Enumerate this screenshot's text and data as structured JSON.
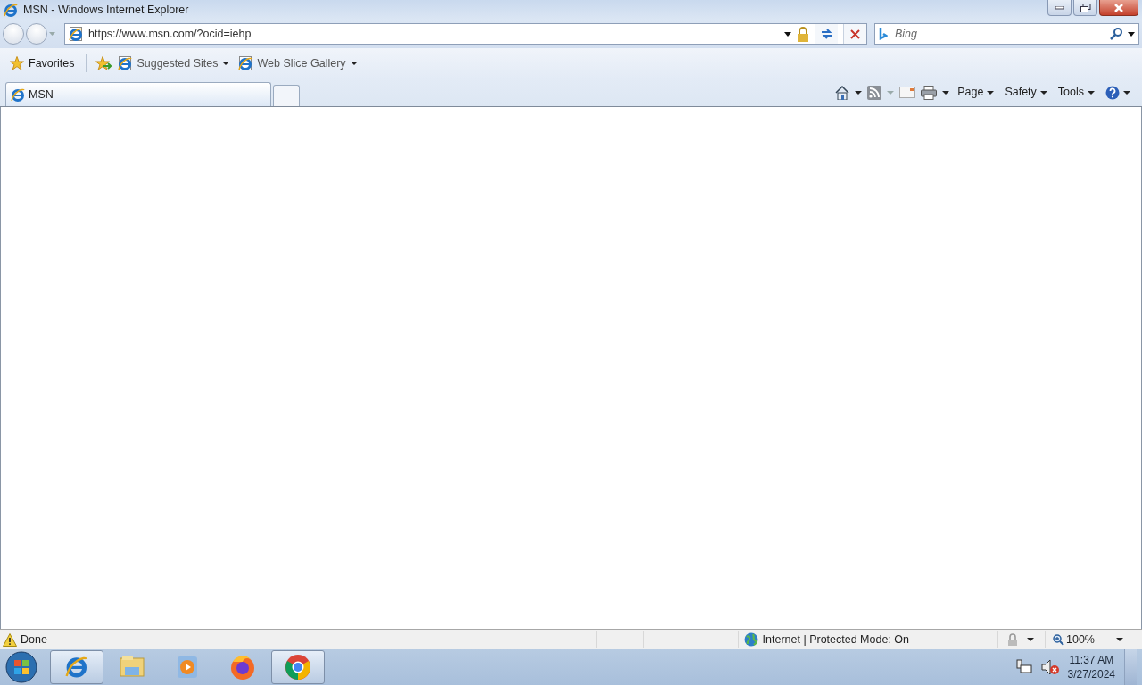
{
  "window": {
    "title": "MSN - Windows Internet Explorer"
  },
  "address_bar": {
    "url": "https://www.msn.com/?ocid=iehp"
  },
  "search": {
    "placeholder": "Bing"
  },
  "favorites_bar": {
    "label": "Favorites",
    "links": [
      {
        "label": "Suggested Sites"
      },
      {
        "label": "Web Slice Gallery"
      }
    ]
  },
  "tabs": [
    {
      "label": "MSN",
      "selected": true
    }
  ],
  "command_bar": {
    "menus": [
      {
        "label": "Page"
      },
      {
        "label": "Safety"
      },
      {
        "label": "Tools"
      }
    ]
  },
  "status_bar": {
    "text": "Done",
    "zone": "Internet | Protected Mode: On",
    "zoom": "100%"
  },
  "taskbar": {
    "apps": [
      {
        "kind": "ie",
        "running": true
      },
      {
        "kind": "explorer",
        "running": false
      },
      {
        "kind": "media",
        "running": false
      },
      {
        "kind": "firefox",
        "running": false
      },
      {
        "kind": "chrome",
        "running": true
      }
    ],
    "clock": {
      "time": "11:37 AM",
      "date": "3/27/2024"
    }
  }
}
